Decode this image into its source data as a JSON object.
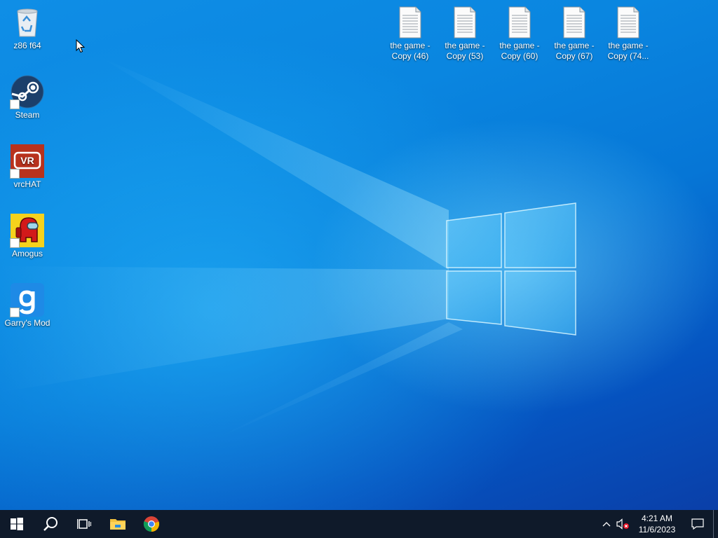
{
  "desktop": {
    "left_icons": [
      {
        "label": "z86 f64",
        "icon": "recycle-bin-icon"
      },
      {
        "label": "Steam",
        "icon": "steam-icon"
      },
      {
        "label": "vrcHAT",
        "icon": "vrchat-icon"
      },
      {
        "label": "Amogus",
        "icon": "among-us-icon"
      },
      {
        "label": "Garry's Mod",
        "icon": "garrys-mod-icon"
      }
    ],
    "file_icons": [
      {
        "line1": "the game -",
        "line2": "Copy (46)"
      },
      {
        "line1": "the game -",
        "line2": "Copy (53)"
      },
      {
        "line1": "the game -",
        "line2": "Copy (60)"
      },
      {
        "line1": "the game -",
        "line2": "Copy (67)"
      },
      {
        "line1": "the game -",
        "line2": "Copy (74..."
      }
    ],
    "vrchat_logo_text": "VR"
  },
  "taskbar": {
    "buttons": [
      "start-icon",
      "search-icon",
      "task-view-icon",
      "file-explorer-icon",
      "chrome-icon"
    ],
    "clock": {
      "time": "4:21 AM",
      "date": "11/6/2023"
    },
    "tray": [
      "show-hidden-icons-chevron",
      "volume-muted-icon",
      "action-center-icon"
    ]
  },
  "colors": {
    "taskbar": "#0f1a2a",
    "desktop_accent": "#0a7ad8"
  }
}
